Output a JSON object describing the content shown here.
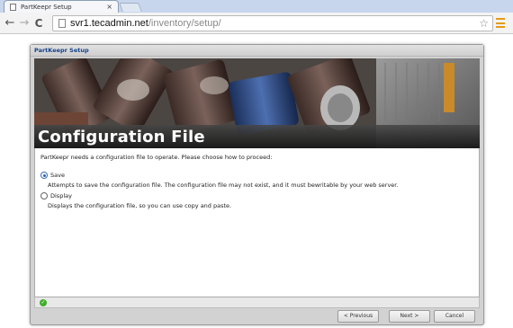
{
  "browser": {
    "tab_title": "PartKeepr Setup",
    "tab_close": "×",
    "url_host": "svr1.tecadmin.net",
    "url_path": "/inventory/setup/",
    "back_icon": "←",
    "forward_icon": "→",
    "reload_icon": "C",
    "star_icon": "☆"
  },
  "dialog": {
    "title": "PartKeepr Setup",
    "heading": "Configuration File",
    "intro": "PartKeepr needs a configuration file to operate. Please choose how to proceed:",
    "options": [
      {
        "label": "Save",
        "checked": true,
        "description": "Attempts to save the configuration file. The configuration file may not exist, and it must bewritable by your web server."
      },
      {
        "label": "Display",
        "checked": false,
        "description": "Displays the configuration file, so you can use copy and paste."
      }
    ],
    "status_icon": "check-icon",
    "buttons": {
      "previous": "< Previous",
      "next": "Next >",
      "cancel": "Cancel"
    }
  },
  "colors": {
    "accent": "#15428b",
    "radio_selected": "#2a62b5",
    "status_ok": "#3fae2a",
    "menu_icon": "#e59a16"
  }
}
